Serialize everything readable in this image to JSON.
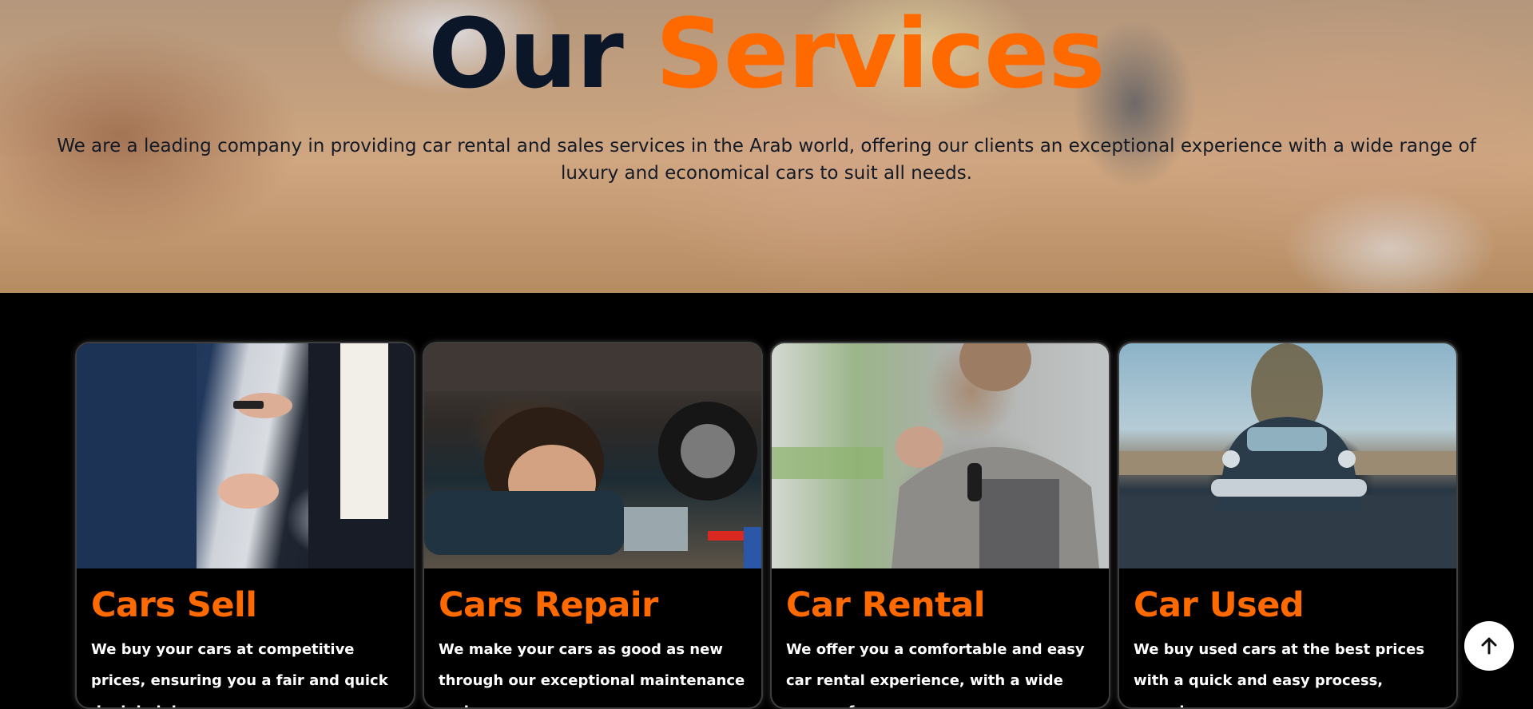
{
  "hero": {
    "title_part1": "Our",
    "title_part2": "Services",
    "description": "We are a leading company in providing car rental and sales services in the Arab world, offering our clients an exceptional experience with a wide range of luxury and economical cars to suit all needs."
  },
  "services": [
    {
      "title": "Cars Sell",
      "text": "We buy your cars at competitive prices, ensuring you a fair and quick deal, helping",
      "image": "handshake-car-sale-photo"
    },
    {
      "title": "Cars Repair",
      "text": "We make your cars as good as new through our exceptional maintenance and",
      "image": "mechanic-under-car-photo"
    },
    {
      "title": "Car Rental",
      "text": "We offer you a comfortable and easy car rental experience, with a wide range of",
      "image": "man-holding-car-keys-photo"
    },
    {
      "title": "Car Used",
      "text": "We buy used cars at the best prices with a quick and easy process, ensuring",
      "image": "vintage-car-parking-lot-photo"
    }
  ],
  "scroll_top": {
    "icon": "arrow-up-icon"
  },
  "colors": {
    "accent": "#ff6a00",
    "heading_dark": "#0b1628",
    "background": "#000000"
  }
}
